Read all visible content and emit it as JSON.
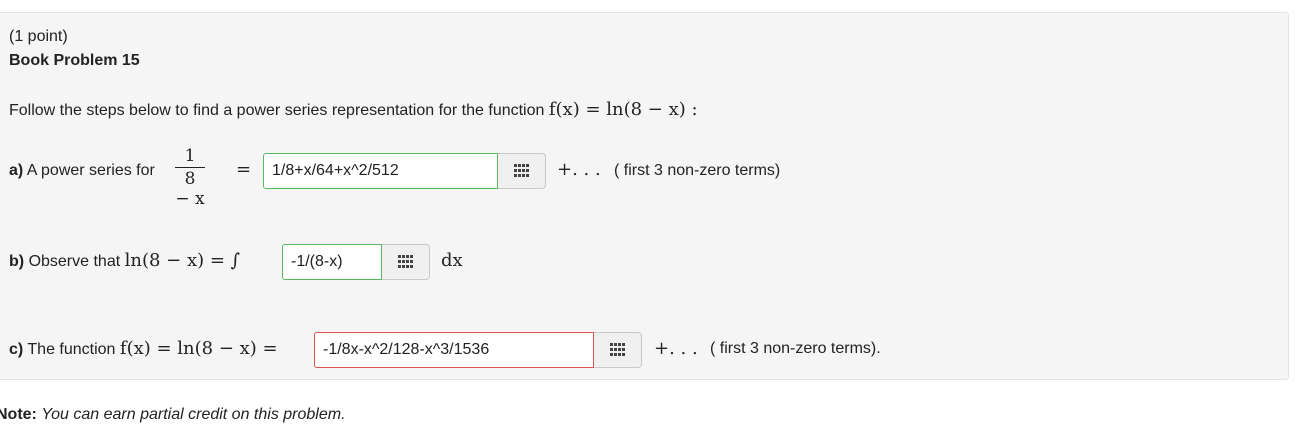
{
  "header": {
    "points": "(1 point)",
    "problem_title": "Book Problem 15"
  },
  "intro": {
    "text": "Follow the steps below to find a power series representation for the function",
    "function": "f(x) = ln(8 − x) :"
  },
  "part_a": {
    "label": "a)",
    "text": "A power series for",
    "frac_num": "1",
    "frac_den": "8 − x",
    "equals": "=",
    "answer": "1/8+x/64+x^2/512",
    "status": "correct",
    "trailing": "+. . .",
    "note": "( first 3 non-zero terms)"
  },
  "part_b": {
    "label": "b)",
    "text": "Observe that",
    "math": "ln(8 − x) = ∫",
    "answer": "-1/(8-x)",
    "status": "correct",
    "trailing": "dx"
  },
  "part_c": {
    "label": "c)",
    "text": "The function",
    "math": "f(x) = ln(8 − x) =",
    "answer": "-1/8x-x^2/128-x^3/1536",
    "status": "incorrect",
    "trailing": "+. . .",
    "note": "( first 3 non-zero terms)."
  },
  "footer": {
    "note_label": "Note:",
    "note_text": "You can earn partial credit on this problem."
  },
  "colors": {
    "correct_border": "#5cb85c",
    "incorrect_border": "#d9534f",
    "panel_bg": "#f5f5f5"
  },
  "icons": {
    "equation_editor": "grid-icon"
  }
}
